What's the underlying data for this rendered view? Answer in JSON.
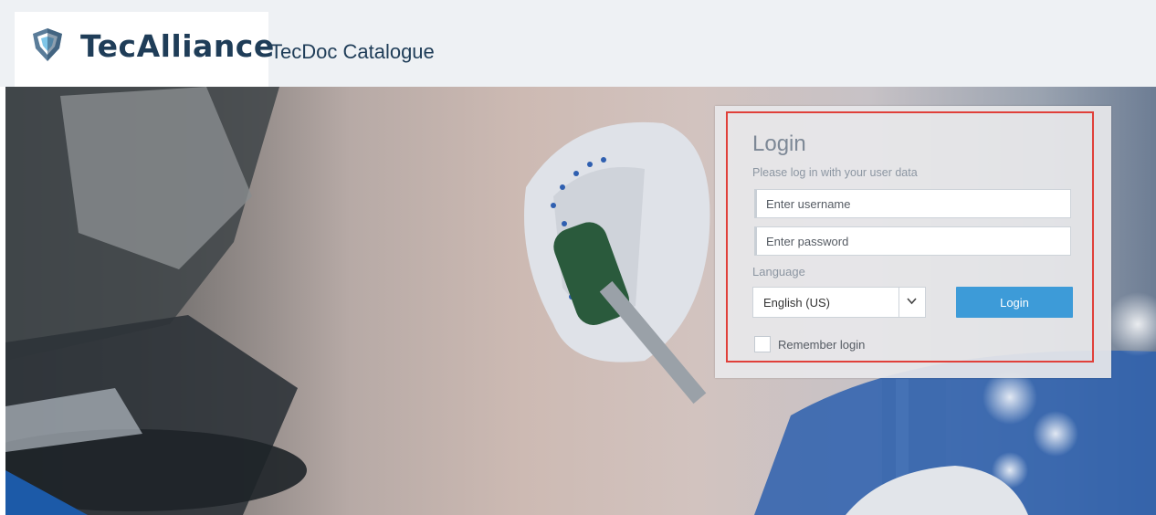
{
  "brand": {
    "logo_icon": "tecalliance-shield-icon",
    "logo_text": "TecAlliance",
    "app_title": "TecDoc Catalogue"
  },
  "login": {
    "title": "Login",
    "subtitle": "Please log in with your user data",
    "username_placeholder": "Enter username",
    "username_value": "",
    "password_placeholder": "Enter password",
    "password_value": "",
    "language_label": "Language",
    "language_selected": "English (US)",
    "language_dropdown_icon": "chevron-down-icon",
    "login_button": "Login",
    "remember_label": "Remember login",
    "remember_checked": false
  },
  "colors": {
    "brand_navy": "#1f3d58",
    "primary_button": "#3d9bd8",
    "highlight_border": "#e0403a"
  }
}
